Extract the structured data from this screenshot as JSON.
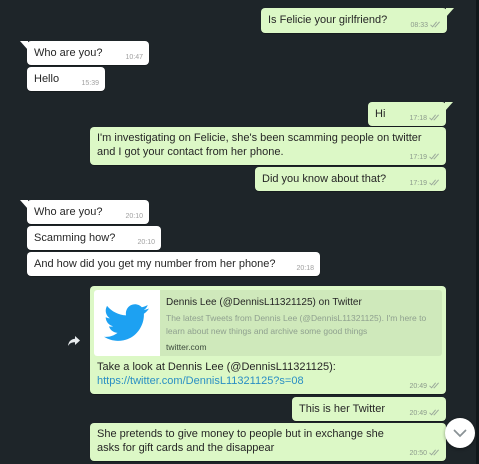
{
  "messages": [
    {
      "text": "Is Felicie your girlfriend?",
      "time": "08:33"
    },
    {
      "text": "Who are you?",
      "time": "10:47"
    },
    {
      "text": "Hello",
      "time": "15:39"
    },
    {
      "text": "Hi",
      "time": "17:18"
    },
    {
      "text": "I'm investigating on Felicie, she's been scamming people on twitter and I got your contact from her phone.",
      "time": "17:19"
    },
    {
      "text": "Did you know about that?",
      "time": "17:19"
    },
    {
      "text": "Who are you?",
      "time": "20:10"
    },
    {
      "text": "Scamming how?",
      "time": "20:10"
    },
    {
      "text": "And how did you get my number from her phone?",
      "time": "20:18"
    },
    {
      "preview_title": "Dennis Lee (@DennisL11321125) on Twitter",
      "preview_desc": "The latest Tweets from Dennis Lee (@DennisL11321125). I'm here to learn about new things and archive some good things",
      "preview_domain": "twitter.com",
      "text": "Take a look at Dennis Lee (@DennisL11321125):",
      "link": "https://twitter.com/DennisL11321125?s=08",
      "time": "20:49"
    },
    {
      "text": "This is her Twitter",
      "time": "20:49"
    },
    {
      "text": "She pretends to give money to people but in exchange she asks for gift cards and the disappear",
      "time": "20:50"
    }
  ],
  "icons": {
    "share": "share-icon",
    "scroll": "chevron-down-icon",
    "twitter": "twitter-bird-icon",
    "read": "double-check-icon"
  },
  "colors": {
    "background": "#1e2529",
    "incoming": "#ffffff",
    "outgoing": "#dcf8c6",
    "link": "#2a8fc4",
    "twitter_blue": "#1da1f2",
    "ticks": "#9aa89a"
  }
}
